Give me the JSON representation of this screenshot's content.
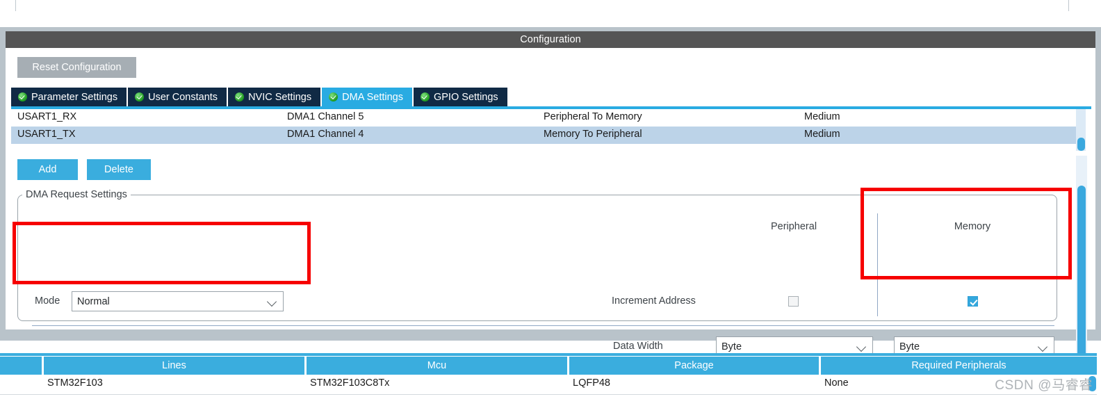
{
  "window": {
    "title": "Configuration"
  },
  "toolbar": {
    "reset_label": "Reset Configuration"
  },
  "tabs": [
    {
      "label": "Parameter Settings",
      "icon": "check-circle-icon",
      "active": false
    },
    {
      "label": "User Constants",
      "icon": "check-circle-icon",
      "active": false
    },
    {
      "label": "NVIC Settings",
      "icon": "check-circle-icon",
      "active": false
    },
    {
      "label": "DMA Settings",
      "icon": "check-circle-icon",
      "active": true
    },
    {
      "label": "GPIO Settings",
      "icon": "check-circle-icon",
      "active": false
    }
  ],
  "dma_list": {
    "rows": [
      {
        "request": "USART1_RX",
        "channel": "DMA1 Channel 5",
        "direction": "Peripheral To Memory",
        "priority": "Medium",
        "selected": false
      },
      {
        "request": "USART1_TX",
        "channel": "DMA1 Channel 4",
        "direction": "Memory To Peripheral",
        "priority": "Medium",
        "selected": true
      }
    ]
  },
  "list_actions": {
    "add_label": "Add",
    "delete_label": "Delete"
  },
  "request_settings": {
    "legend": "DMA Request Settings",
    "col_peripheral": "Peripheral",
    "col_memory": "Memory",
    "mode_label": "Mode",
    "mode_value": "Normal",
    "increment_label": "Increment Address",
    "increment_peripheral_checked": "false",
    "increment_memory_checked": "true",
    "data_width_label": "Data Width",
    "data_width_peripheral": "Byte",
    "data_width_memory": "Byte"
  },
  "bottom_table": {
    "headers": [
      "",
      "Lines",
      "Mcu",
      "Package",
      "Required Peripherals"
    ],
    "row": [
      "",
      "STM32F103",
      "STM32F103C8Tx",
      "LQFP48",
      "None"
    ]
  },
  "watermark": {
    "text": "CSDN @马睿睿"
  },
  "colors": {
    "accent_blue": "#3aadde",
    "tab_dark": "#102a45",
    "title_gray": "#555555",
    "frame_gray": "#b9c3ca",
    "selection_blue": "#bcd3e8",
    "annotation_red": "#f60000"
  }
}
